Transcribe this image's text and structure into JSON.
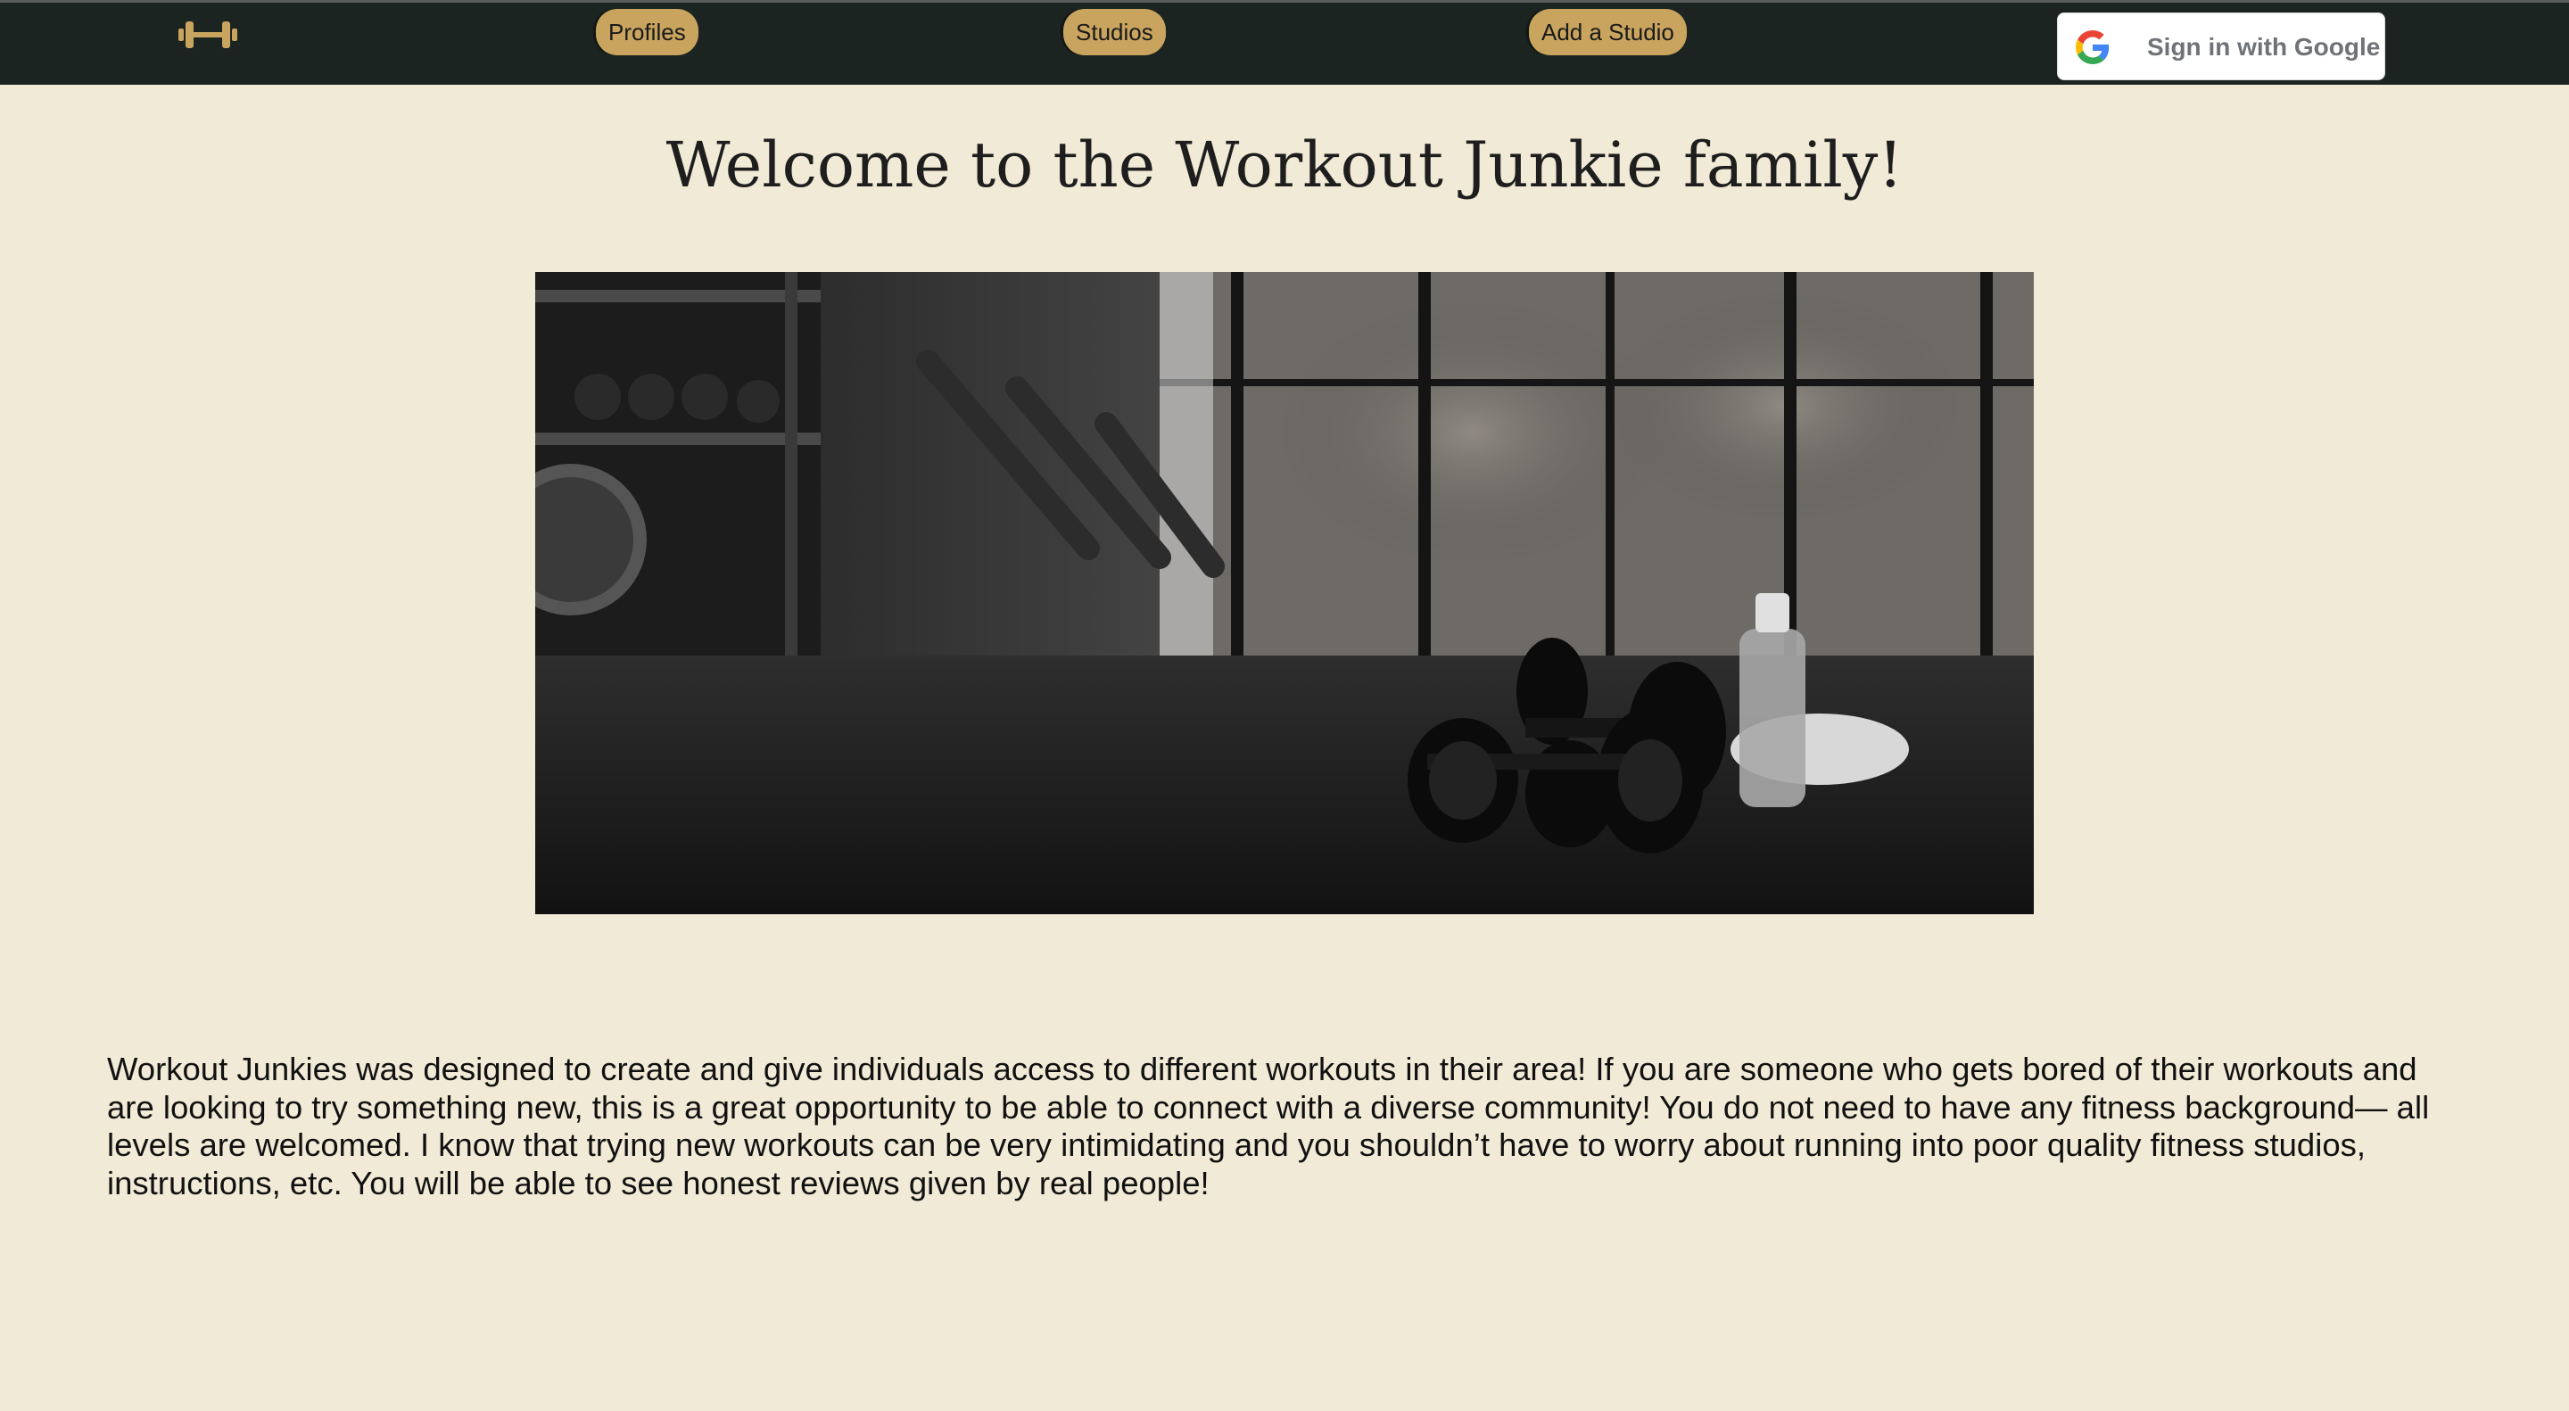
{
  "nav": {
    "logo_icon": "dumbbell-icon",
    "items": [
      {
        "label": "Profiles"
      },
      {
        "label": "Studios"
      },
      {
        "label": "Add a Studio"
      }
    ],
    "google_signin": {
      "label": "Sign in with Google",
      "icon": "google-logo-icon"
    }
  },
  "main": {
    "title": "Welcome to the Workout Junkie family!",
    "hero_image": {
      "icon": "gym-dumbbells-photo"
    },
    "intro": "Workout Junkies was designed to create and give individuals access to different workouts in their area! If you are someone who gets bored of their workouts and are looking to try something new, this is a great opportunity to be able to connect with a diverse community! You do not need to have any fitness background— all levels are welcomed. I know that trying new workouts can be very intimidating and you shouldn’t have to worry about running into poor quality fitness studios, instructions, etc. You will be able to see honest reviews given by real people!"
  },
  "colors": {
    "navbar": "#1b2420",
    "accent": "#c9a45e",
    "page_background": "#f1ead6"
  }
}
